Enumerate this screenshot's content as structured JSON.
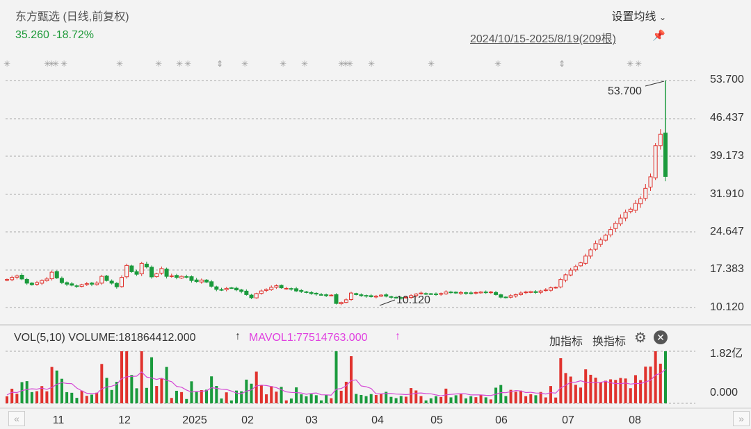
{
  "header": {
    "title": "东方甄选 (日线,前复权)",
    "price_change": "35.260 -18.72%",
    "settings_label": "设置均线",
    "settings_chevron": "chevron-down-icon",
    "date_range": "2024/10/15-2025/8/19(209根)",
    "pin_icon": "pin-icon"
  },
  "volume_panel": {
    "title": "VOL(5,10)  VOLUME:181864412.000",
    "mavol_label": "MAVOL1:77514763.000",
    "arrow": "↑",
    "add_indicator": "加指标",
    "switch_indicator": "换指标",
    "gear_icon": "gear-icon",
    "close_icon": "close-icon",
    "y_ticks": [
      "1.82亿",
      "0.000"
    ]
  },
  "colors": {
    "up": "#e0322d",
    "down": "#1a9a3c",
    "mavol": "#d548d5",
    "grid": "#a8a8a8"
  },
  "nav": {
    "left": "«",
    "right": "»"
  },
  "chart_data": {
    "type": "candlestick",
    "title": "东方甄选 (日线,前复权)",
    "y_ticks": [
      "53.700",
      "46.437",
      "39.173",
      "31.910",
      "24.647",
      "17.383",
      "10.120"
    ],
    "y_range": [
      10.12,
      53.7
    ],
    "x_tick_labels": [
      "11",
      "12",
      "2025",
      "02",
      "03",
      "04",
      "05",
      "06",
      "07",
      "08"
    ],
    "annotations": [
      {
        "label": "53.700",
        "value": 53.7,
        "note": "max"
      },
      {
        "label": "10.120",
        "value": 10.12,
        "note": "min"
      }
    ],
    "last_close": 35.26,
    "last_change_pct": -18.72,
    "bars": 209,
    "approx_close_series": [
      15.5,
      15.9,
      16.2,
      15.6,
      14.8,
      14.5,
      14.9,
      15.3,
      15.6,
      16.9,
      15.8,
      14.9,
      14.6,
      14.4,
      14.2,
      14.5,
      14.7,
      14.6,
      14.8,
      16.1,
      15.3,
      14.8,
      14.1,
      15.9,
      18.2,
      17.0,
      16.5,
      18.6,
      17.9,
      16.0,
      16.6,
      17.6,
      16.1,
      16.2,
      15.9,
      16.1,
      16.0,
      15.3,
      15.1,
      15.4,
      15.0,
      14.2,
      13.6,
      13.5,
      13.8,
      13.9,
      13.5,
      13.2,
      12.6,
      12.0,
      12.8,
      13.3,
      13.6,
      14.0,
      14.3,
      13.9,
      13.8,
      13.7,
      13.3,
      13.2,
      13.0,
      12.8,
      12.7,
      12.6,
      12.4,
      12.5,
      10.9,
      11.1,
      11.6,
      12.9,
      12.6,
      12.4,
      12.3,
      12.2,
      12.3,
      12.5,
      12.3,
      12.1,
      12.0,
      11.9,
      12.1,
      12.4,
      12.7,
      12.9,
      12.8,
      12.7,
      12.6,
      12.8,
      13.1,
      13.0,
      12.9,
      13.0,
      12.9,
      12.8,
      13.0,
      13.1,
      13.0,
      13.1,
      12.6,
      12.1,
      12.0,
      12.4,
      12.6,
      12.9,
      13.1,
      13.2,
      13.0,
      13.3,
      13.5,
      13.9,
      14.0,
      15.5,
      16.4,
      17.3,
      18.0,
      18.7,
      20.0,
      21.2,
      22.4,
      23.1,
      24.0,
      25.1,
      26.3,
      27.3,
      28.4,
      29.0,
      30.1,
      31.0,
      33.0,
      35.2,
      41.2,
      43.4,
      35.26
    ],
    "volume_ticks": [
      "1.82亿",
      "0.000"
    ]
  }
}
